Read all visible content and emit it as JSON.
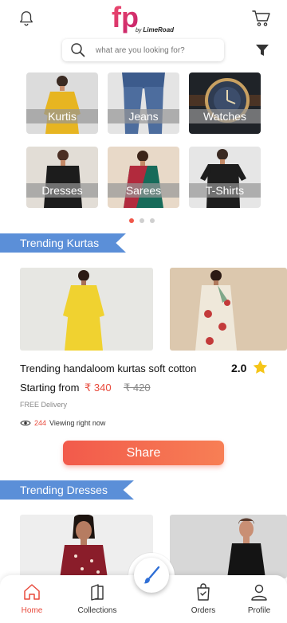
{
  "header": {
    "logo_text": "fp",
    "logo_sub_prefix": "by",
    "logo_sub_brand": "LimeRoad"
  },
  "search": {
    "placeholder": "what are you looking for?"
  },
  "categories": [
    {
      "label": "Kurtis"
    },
    {
      "label": "Jeans"
    },
    {
      "label": "Watches"
    },
    {
      "label": "Dresses"
    },
    {
      "label": "Sarees"
    },
    {
      "label": "T-Shirts"
    }
  ],
  "carousel": {
    "page_count": 3,
    "active_index": 0
  },
  "sections": {
    "kurtas_title": "Trending Kurtas",
    "dresses_title": "Trending Dresses"
  },
  "product": {
    "title": "Trending handaloom kurtas soft cotton",
    "rating": "2.0",
    "starting_from": "Starting from",
    "price": "₹ 340",
    "mrp": "₹ 420",
    "delivery": "FREE Delivery",
    "viewing_count": "244",
    "viewing_text": "Viewing right now",
    "share_label": "Share"
  },
  "bottom_nav": {
    "home": "Home",
    "collections": "Collections",
    "orders": "Orders",
    "profile": "Profile"
  },
  "colors": {
    "accent": "#e84a3c",
    "ribbon": "#5b8fd8",
    "star": "#f5c518"
  }
}
